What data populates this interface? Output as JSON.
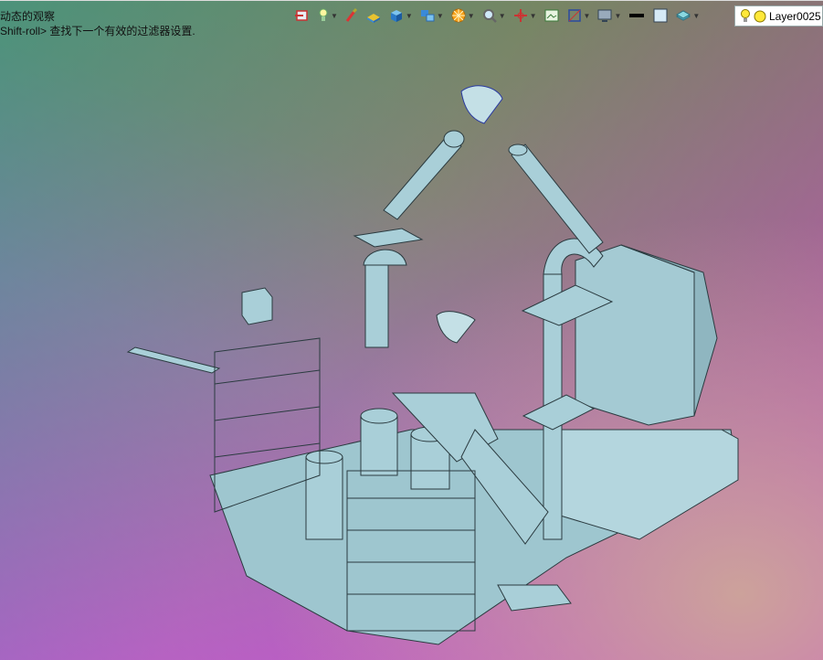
{
  "hints": {
    "line1": "动态的观察",
    "line2": "Shift-roll> 查找下一个有效的过滤器设置."
  },
  "toolbar": {
    "items": [
      "view-orientation-icon",
      "light-icon",
      "select-filter-icon",
      "part-icon",
      "box-icon",
      "display-mode-icon",
      "orange-wheel-icon",
      "magnifier-icon",
      "axis-icon",
      "frame-icon",
      "section-icon",
      "monitor-icon",
      "line-color-icon",
      "fill-color-icon",
      "layer-stack-icon"
    ]
  },
  "layer": {
    "name": "Layer0025"
  },
  "colors": {
    "model_fill": "#a9cfd8",
    "model_stroke": "#2b3b40",
    "bg_top_right": "#5aa02e",
    "bg_bottom_left": "#e030e8"
  }
}
